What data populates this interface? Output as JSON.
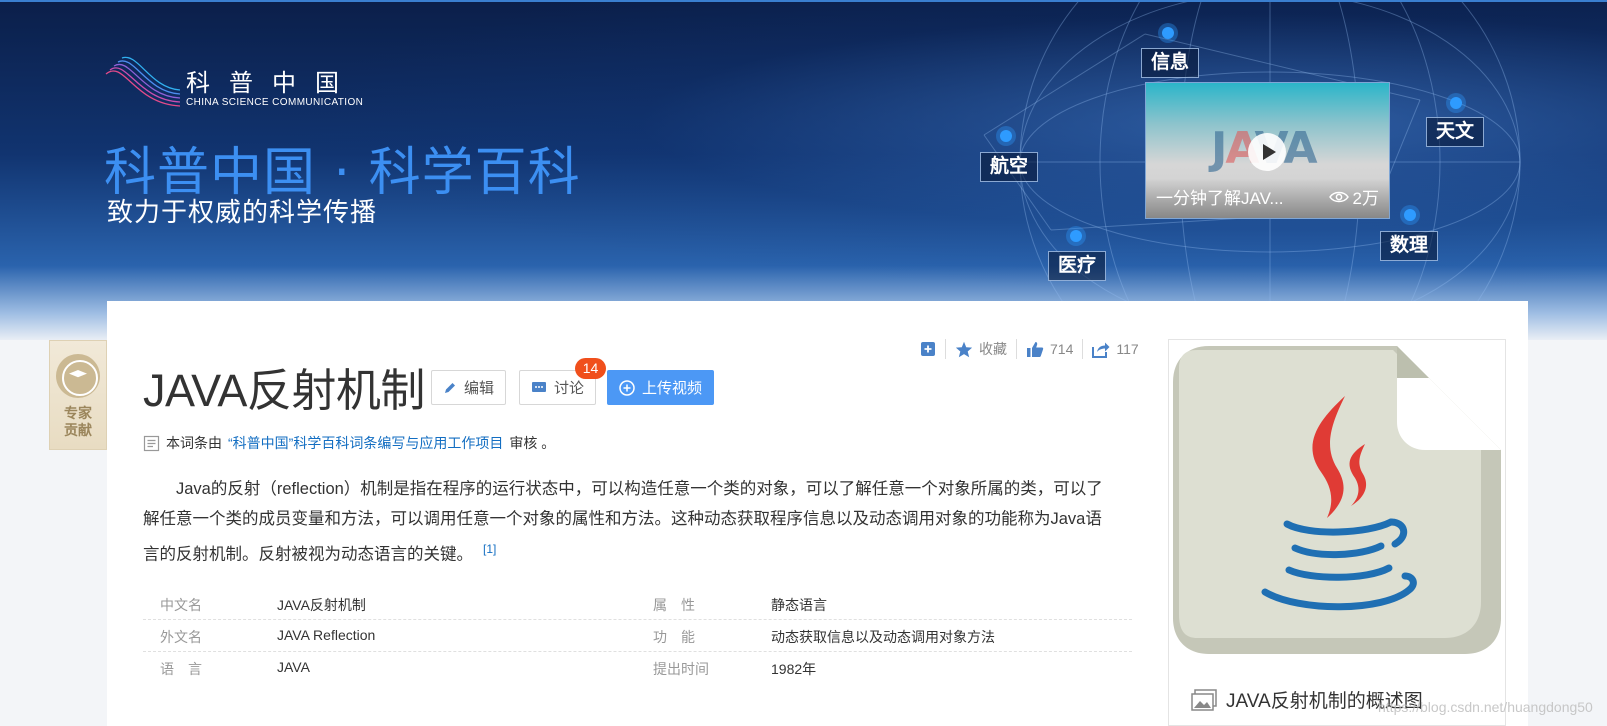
{
  "banner": {
    "logo_cn": "科普中国",
    "logo_en": "CHINA SCIENCE COMMUNICATION",
    "title": "科普中国 · 科学百科",
    "subtitle": "致力于权威的科学传播",
    "tags": {
      "info": "信息",
      "aviation": "航空",
      "medical": "医疗",
      "astronomy": "天文",
      "math": "数理"
    },
    "video": {
      "title": "一分钟了解JAV...",
      "views": "2万"
    }
  },
  "article": {
    "title": "JAVA反射机制",
    "edit_label": "编辑",
    "discuss_label": "讨论",
    "discuss_count": "14",
    "upload_label": "上传视频",
    "favorite_label": "收藏",
    "like_count": "714",
    "share_count": "117",
    "review_prefix": "本词条由",
    "review_link": "“科普中国”科学百科词条编写与应用工作项目",
    "review_suffix": "审核 。",
    "summary": "Java的反射（reflection）机制是指在程序的运行状态中，可以构造任意一个类的对象，可以了解任意一个对象所属的类，可以了解任意一个类的成员变量和方法，可以调用任意一个对象的属性和方法。这种动态获取程序信息以及动态调用对象的功能称为Java语言的反射机制。反射被视为动态语言的关键。",
    "citation": "[1]",
    "expert_label_1": "专家",
    "expert_label_2": "贡献"
  },
  "info_table": [
    {
      "k1": "中文名",
      "v1": "JAVA反射机制",
      "k2": "属　性",
      "v2": "静态语言"
    },
    {
      "k1": "外文名",
      "v1": "JAVA Reflection",
      "k2": "功　能",
      "v2": "动态获取信息以及动态调用对象方法"
    },
    {
      "k1": "语　言",
      "v1": "JAVA",
      "k2": "提出时间",
      "v2": "1982年"
    }
  ],
  "side": {
    "caption": "JAVA反射机制的概述图"
  },
  "watermark": "https://blog.csdn.net/huangdong50"
}
